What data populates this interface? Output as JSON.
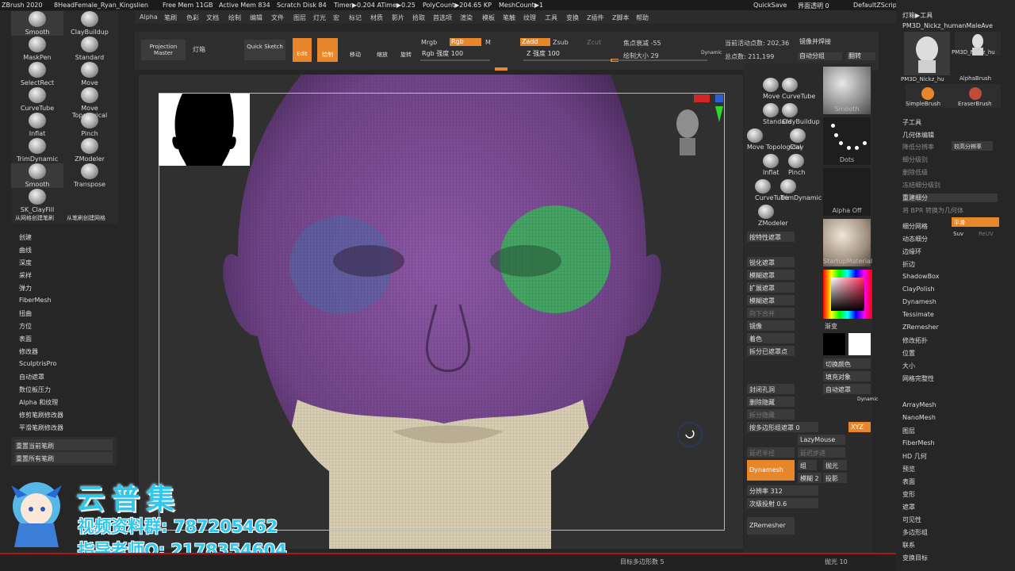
{
  "titlebar": {
    "app": "ZBrush 2020",
    "file": "8HeadFemale_Ryan_Kingslien",
    "free_mem": "Free Mem 11GB",
    "active_mem": "Active Mem 834",
    "scratch": "Scratch Disk 84",
    "timer": "Timer▶0.204 ATime▶0.25",
    "polycount": "PolyCount▶204.65 KP",
    "meshcount": "MeshCount▶1",
    "quicksave": "QuickSave",
    "transparency": "界面透明 0",
    "script": "DefaultZScript"
  },
  "menu": [
    "Alpha",
    "笔刷",
    "色彩",
    "文档",
    "绘制",
    "编辑",
    "文件",
    "图层",
    "灯光",
    "宏",
    "标记",
    "材质",
    "影片",
    "拾取",
    "首选项",
    "渲染",
    "模板",
    "笔触",
    "纹理",
    "工具",
    "变换",
    "Z插件",
    "Z脚本",
    "帮助"
  ],
  "left_brushes": [
    {
      "label": "Smooth"
    },
    {
      "label": "ClayBuildup"
    },
    {
      "label": "MaskPen"
    },
    {
      "label": "Standard"
    },
    {
      "label": "SelectRect"
    },
    {
      "label": "Move"
    },
    {
      "label": "CurveTube"
    },
    {
      "label": "Move Topological"
    },
    {
      "label": "Inflat"
    },
    {
      "label": "Pinch"
    },
    {
      "label": "TrimDynamic"
    },
    {
      "label": "ZModeler"
    },
    {
      "label": "Smooth"
    },
    {
      "label": "Transpose"
    },
    {
      "label": "SK_ClayFill"
    }
  ],
  "left_brush_footer": {
    "left": "从网格创建笔刷",
    "right": "从笔刷创建网格"
  },
  "left_menu": [
    "创建",
    "曲线",
    "深度",
    "采样",
    "弹力",
    "FiberMesh",
    "扭曲",
    "方位",
    "表面",
    "修改器",
    "SculptrisPro",
    "自动遮罩",
    "数位板压力",
    "Alpha 和纹理",
    "修剪笔刷修改器",
    "平滑笔刷修改器"
  ],
  "left_reset": [
    "重置当前笔刷",
    "重置所有笔刷"
  ],
  "toolbar": {
    "projection_master": "Projection Master",
    "lightbox": "灯箱",
    "quick_sketch": "Quick Sketch",
    "edit": "Edit",
    "draw": "绘制",
    "move": "移动",
    "scale": "缩放",
    "rotate": "旋转",
    "mrgb": "Mrgb",
    "rgb": "Rgb",
    "m": "M",
    "rgb_intensity": "Rgb 强度 100",
    "zadd": "Zadd",
    "zsub": "Zsub",
    "zcut": "Zcut",
    "z_intensity": "Z 强度 100",
    "focal_shift": "焦点衰减 -55",
    "draw_size": "绘制大小 29",
    "dynamic": "Dynamic",
    "active_points": "当前活动点数: 202,36",
    "total_points": "总点数: 211,199",
    "auto_group": "自动分组",
    "flip": "翻转",
    "mirror_weld": "镜像并焊接"
  },
  "right_brushes": [
    {
      "label": "Move"
    },
    {
      "label": "CurveTube"
    },
    {
      "label": "Standard"
    },
    {
      "label": "ClayBuildup"
    },
    {
      "label": "Move Topological"
    },
    {
      "label": "Clay"
    },
    {
      "label": "Inflat"
    },
    {
      "label": "Pinch"
    },
    {
      "label": "CurveTube"
    },
    {
      "label": "TrimDynamic"
    },
    {
      "label": "ZModeler"
    }
  ],
  "right_previews": {
    "smooth": "Smooth",
    "dots": "Dots",
    "alpha_off": "Alpha Off",
    "material": "StartupMaterial",
    "gradient": "渐变"
  },
  "right_buttons": [
    "按特性遮罩",
    "锐化遮罩",
    "模糊遮罩",
    "扩展遮罩",
    "模糊遮罩",
    "向下合并",
    "镜像",
    "着色",
    "拆分已遮罩点"
  ],
  "right_buttons2": {
    "seal": "封闭孔洞",
    "del_hidden": "删除隐藏",
    "split_hidden": "拆分隐藏",
    "poly_mask": "按多边形组遮罩 0",
    "switch_color": "切换颜色",
    "fill_obj": "填充对象",
    "mask_self": "自动遮罩",
    "lazymouse": "LazyMouse",
    "lazy_radius": "延迟半径",
    "lazy_step": "延迟步进",
    "dynamesh": "Dynamesh",
    "group": "组",
    "polish": "抛光",
    "blur": "模糊 2",
    "project": "投影",
    "resolution": "分辨率 312",
    "sub_projection": "次级投射 0.6",
    "zremesher": "ZRemesher",
    "xyz": "XYZ",
    "dynamic": "Dynamic"
  },
  "tool_panel": {
    "header": "灯箱▶工具",
    "tool_name": "PM3D_Nickz_humanMaleAve",
    "thumbs": [
      "PM3D_Nickz_hu",
      "PM3D_Nickz_hu",
      "AlphaBrush",
      "SimpleBrush",
      "EraserBrush"
    ],
    "subtool": "子工具",
    "geometry": "几何体编辑",
    "items": [
      "降低分辨率",
      "细分级别",
      "删除低级",
      "冻结细分级别",
      "重建细分",
      "将 BPR 转换为几何体",
      "细分网格",
      "动态细分",
      "边缘环",
      "折边",
      "ShadowBox",
      "ClayPolish",
      "Dynamesh",
      "Tessimate",
      "ZRemesher",
      "修改拓扑",
      "位置",
      "大小",
      "网格完整性"
    ],
    "high_res": "较高分辨率",
    "smooth": "平滑",
    "suv": "Suv",
    "reuv": "ReUV",
    "lower_items": [
      "ArrayMesh",
      "NanoMesh",
      "图层",
      "FiberMesh",
      "HD 几何",
      "预览",
      "表面",
      "变形",
      "遮罩",
      "可见性",
      "多边形组",
      "联系",
      "变换目标"
    ]
  },
  "watermark": {
    "title": "云普集",
    "line1": "视频资料群: 787205462",
    "line2": "指导老师Q: 2178354604"
  },
  "bottom": {
    "target_poly": "目标多边形数 5",
    "polish": "抛光 10"
  },
  "colors": {
    "accent": "#e8862b",
    "mesh_purple": "#7a4b93",
    "mask_green": "#3bb25a",
    "mask_blue": "#4d6aa8",
    "skin": "#d8cdb2"
  }
}
